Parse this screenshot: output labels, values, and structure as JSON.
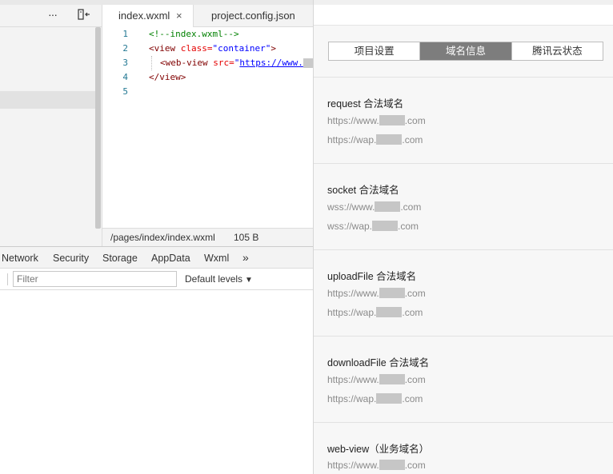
{
  "toolbar": {
    "more_icon": "ellipsis-icon",
    "dock_icon": "dock-left-icon"
  },
  "editor_tabs": [
    {
      "label": "index.wxml",
      "close_label": "×"
    },
    {
      "label": "project.config.json"
    }
  ],
  "code_lines": [
    {
      "number": "1",
      "text": "<!--index.wxml-->"
    },
    {
      "number": "2",
      "tag_open": "<view ",
      "attr": "class=",
      "value": "\"container\"",
      "tag_close": ">"
    },
    {
      "number": "3",
      "tag_open": "<web-view ",
      "attr": "src=",
      "value_prefix": "\"",
      "url": "https://www."
    },
    {
      "number": "4",
      "text": "</view>"
    },
    {
      "number": "5",
      "text": ""
    }
  ],
  "status_bar": {
    "path": "/pages/index/index.wxml",
    "size": "105 B"
  },
  "devtools_tabs": [
    "Network",
    "Security",
    "Storage",
    "AppData",
    "Wxml"
  ],
  "devtools_more": "»",
  "console": {
    "filter_placeholder": "Filter",
    "levels": "Default levels",
    "levels_arrow": "▼"
  },
  "panel_tabs": [
    {
      "label": "项目设置",
      "active": false
    },
    {
      "label": "域名信息",
      "active": true
    },
    {
      "label": "腾讯云状态",
      "active": false
    }
  ],
  "domain_sections": [
    {
      "title": "request 合法域名",
      "entries": [
        {
          "pre": "https://www.",
          "post": ".com"
        },
        {
          "pre": "https://wap.",
          "post": ".com"
        }
      ]
    },
    {
      "title": "socket 合法域名",
      "entries": [
        {
          "pre": "wss://www.",
          "post": ".com"
        },
        {
          "pre": "wss://wap.",
          "post": ".com"
        }
      ]
    },
    {
      "title": "uploadFile 合法域名",
      "entries": [
        {
          "pre": "https://www.",
          "post": ".com"
        },
        {
          "pre": "https://wap.",
          "post": ".com"
        }
      ]
    },
    {
      "title": "downloadFile 合法域名",
      "entries": [
        {
          "pre": "https://www.",
          "post": ".com"
        },
        {
          "pre": "https://wap.",
          "post": ".com"
        }
      ]
    },
    {
      "title": "web-view（业务域名）",
      "entries": [
        {
          "pre": "https://www.",
          "post": ".com"
        }
      ]
    }
  ],
  "colors": {
    "active_tab": "#7d7d7d",
    "comment": "#008000",
    "tag": "#800000",
    "attr": "#e50000",
    "string": "#0000ff"
  }
}
